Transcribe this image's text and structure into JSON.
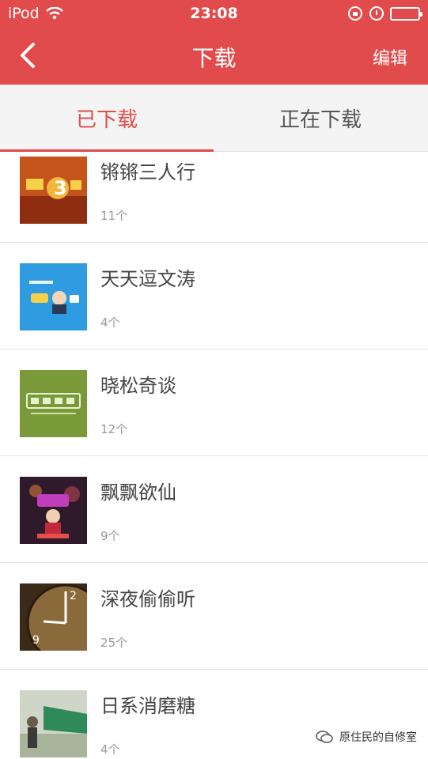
{
  "status": {
    "device": "iPod",
    "time": "23:08"
  },
  "nav": {
    "title": "下载",
    "edit": "编辑"
  },
  "tabs": [
    {
      "label": "已下载"
    },
    {
      "label": "正在下载"
    }
  ],
  "items": [
    {
      "title": "锵锵三人行",
      "count": "11个",
      "thumb_icon": "qiangqiang-cover-icon"
    },
    {
      "title": "天天逗文涛",
      "count": "4个",
      "thumb_icon": "tiantian-cover-icon"
    },
    {
      "title": "晓松奇谈",
      "count": "12个",
      "thumb_icon": "xiaosong-cover-icon"
    },
    {
      "title": "飘飘欲仙",
      "count": "9个",
      "thumb_icon": "piaopiao-cover-icon"
    },
    {
      "title": "深夜偷偷听",
      "count": "25个",
      "thumb_icon": "clock-cover-icon"
    },
    {
      "title": "日系消磨糖",
      "count": "4个",
      "thumb_icon": "rixi-cover-icon"
    }
  ],
  "watermark": {
    "text": "原住民的自修室"
  },
  "colors": {
    "accent": "#e24b4b",
    "text": "#444444",
    "subtle": "#999999"
  }
}
